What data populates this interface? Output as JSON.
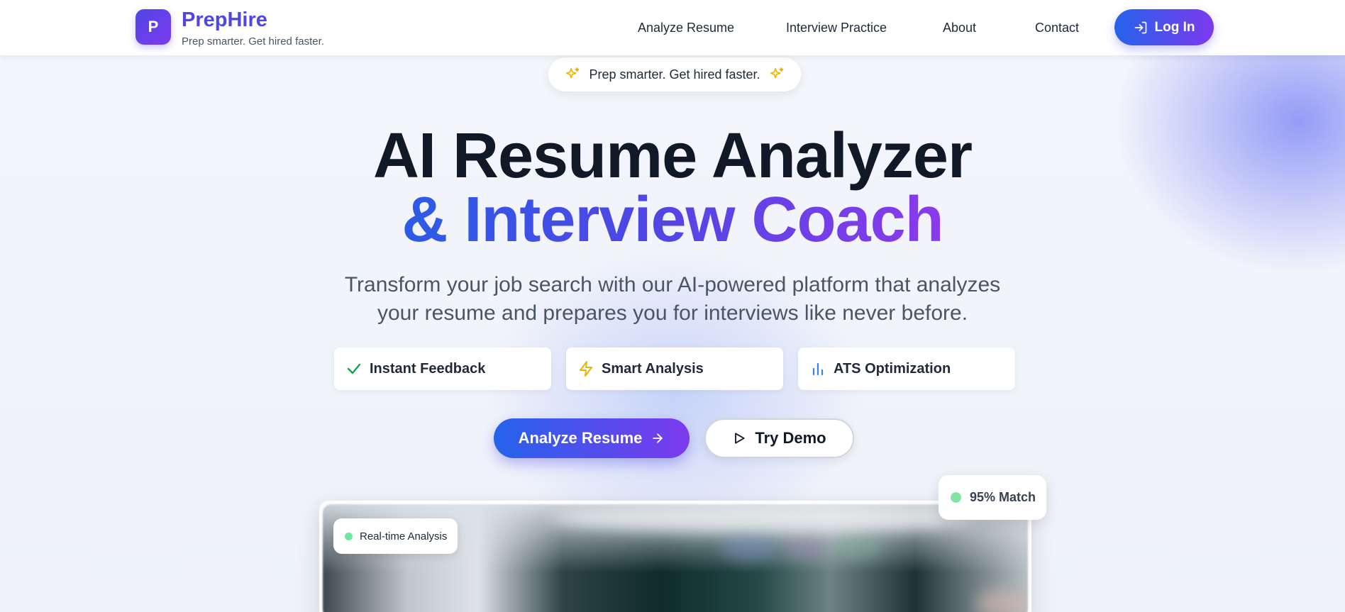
{
  "nav": {
    "logo_letter": "P",
    "brand_name": "PrepHire",
    "brand_tagline": "Prep smarter. Get hired faster.",
    "links": [
      "Analyze Resume",
      "Interview Practice",
      "About",
      "Contact"
    ],
    "login_label": "Log In",
    "login_icon": "log-in-icon"
  },
  "hero": {
    "pill_text": "Prep smarter. Get hired faster.",
    "pill_icon": "sparkles-icon",
    "title_line1": "AI Resume Analyzer",
    "title_line2": "& Interview Coach",
    "subtitle_line1": "Transform your job search with our AI-powered platform that analyzes",
    "subtitle_line2": "your resume and prepares you for interviews like never before.",
    "features": [
      {
        "label": "Instant Feedback",
        "icon": "check-icon",
        "color": "#16a34a"
      },
      {
        "label": "Smart Analysis",
        "icon": "zap-icon",
        "color": "#eab308"
      },
      {
        "label": "ATS Optimization",
        "icon": "bar-chart-icon",
        "color": "#3b82f6"
      }
    ],
    "primary_cta": "Analyze Resume",
    "secondary_cta": "Try Demo"
  },
  "preview": {
    "realtime_badge": "Real-time Analysis",
    "match_badge": "95% Match"
  },
  "colors": {
    "brand": "#4f46e5",
    "gradient_start": "#2563eb",
    "gradient_end": "#7c3aed",
    "status_green": "#6ee7a0"
  }
}
